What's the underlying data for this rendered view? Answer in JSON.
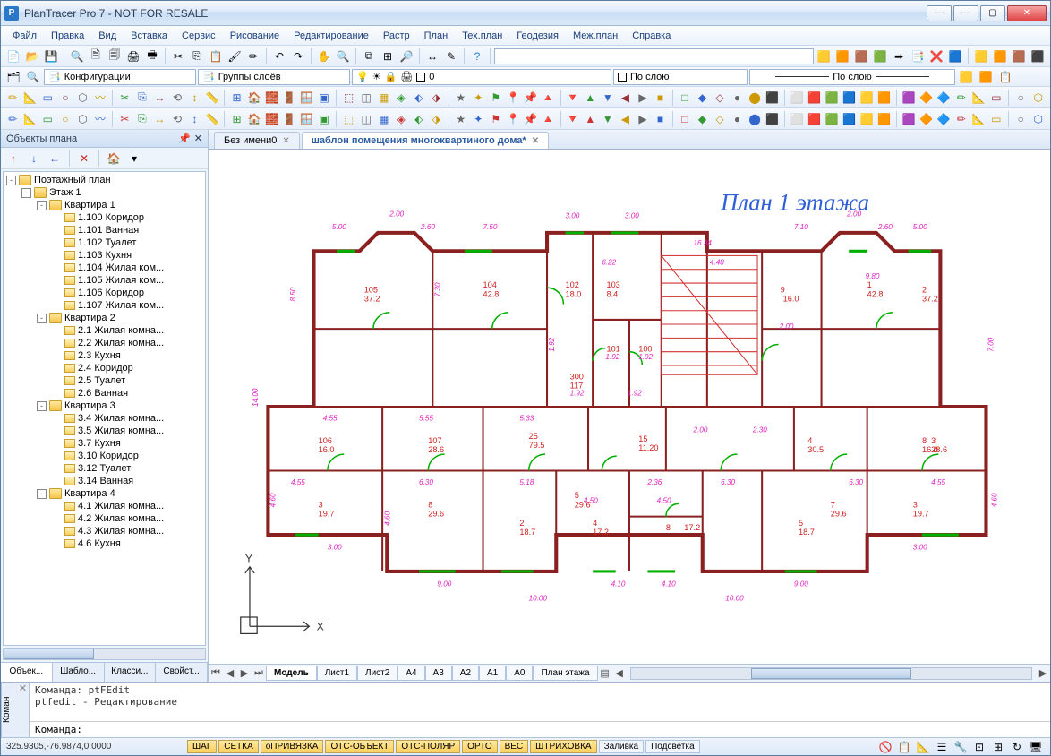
{
  "title": "PlanTracer Pro 7 - NOT FOR RESALE",
  "menu": [
    "Файл",
    "Правка",
    "Вид",
    "Вставка",
    "Сервис",
    "Рисование",
    "Редактирование",
    "Растр",
    "План",
    "Тех.план",
    "Геодезия",
    "Меж.план",
    "Справка"
  ],
  "config": {
    "label1": "Конфигурации",
    "label2": "Группы слоёв",
    "layer_num": "0",
    "by_layer": "По слою",
    "by_layer2": "По слою"
  },
  "panel": {
    "title": "Объекты плана",
    "tabs": [
      "Объек...",
      "Шабло...",
      "Класси...",
      "Свойст..."
    ]
  },
  "tree": {
    "root": "Поэтажный план",
    "floor": "Этаж 1",
    "apartments": [
      {
        "name": "Квартира 1",
        "rooms": [
          "1.100 Коридор",
          "1.101 Ванная",
          "1.102 Туалет",
          "1.103 Кухня",
          "1.104 Жилая ком...",
          "1.105 Жилая ком...",
          "1.106 Коридор",
          "1.107 Жилая ком..."
        ]
      },
      {
        "name": "Квартира 2",
        "rooms": [
          "2.1 Жилая комна...",
          "2.2 Жилая комна...",
          "2.3 Кухня",
          "2.4 Коридор",
          "2.5 Туалет",
          "2.6 Ванная"
        ]
      },
      {
        "name": "Квартира 3",
        "rooms": [
          "3.4 Жилая комна...",
          "3.5 Жилая комна...",
          "3.7 Кухня",
          "3.10 Коридор",
          "3.12 Туалет",
          "3.14 Ванная"
        ]
      },
      {
        "name": "Квартира 4",
        "rooms": [
          "4.1 Жилая комна...",
          "4.2 Жилая комна...",
          "4.3 Жилая комна...",
          "4.6 Кухня"
        ]
      }
    ]
  },
  "doc_tabs": [
    {
      "label": "Без имени0",
      "active": false
    },
    {
      "label": "шаблон помещения многоквартиного дома*",
      "active": true
    }
  ],
  "layout_tabs": [
    "Модель",
    "Лист1",
    "Лист2",
    "A4",
    "A3",
    "A2",
    "A1",
    "A0",
    "План этажа"
  ],
  "plan_title": "План 1 этажа",
  "command": {
    "label": "Коман",
    "log": [
      "Команда: ptFEdit",
      "ptfedit - Редактирование"
    ],
    "prompt": "Команда:"
  },
  "status": {
    "coords": "325.9305,-76.9874,0.0000",
    "buttons": [
      "ШАГ",
      "СЕТКА",
      "оПРИВЯЗКА",
      "ОТС-ОБЪЕКТ",
      "ОТС-ПОЛЯР",
      "ОРТО",
      "ВЕС",
      "ШТРИХОВКА",
      "Заливка",
      "Подсветка"
    ]
  },
  "axis": {
    "x": "X",
    "y": "Y"
  }
}
